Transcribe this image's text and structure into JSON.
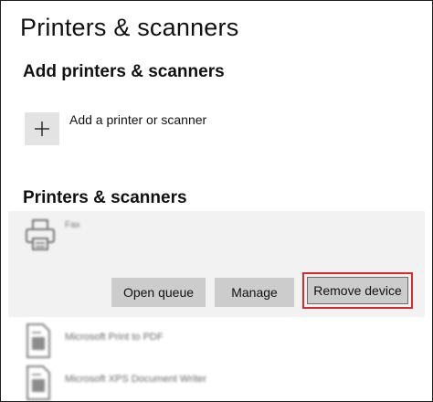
{
  "page": {
    "title": "Printers & scanners"
  },
  "add_section": {
    "heading": "Add printers & scanners",
    "add_label": "Add a printer or scanner"
  },
  "list_section": {
    "heading": "Printers & scanners",
    "selected": {
      "name": "Fax",
      "icon": "printer-icon",
      "buttons": {
        "open_queue": "Open queue",
        "manage": "Manage",
        "remove_device": "Remove device"
      }
    },
    "items": [
      {
        "name": "Microsoft Print to PDF",
        "icon": "document-icon"
      },
      {
        "name": "Microsoft XPS Document Writer",
        "icon": "document-icon"
      }
    ]
  },
  "colors": {
    "highlight": "#d92b2b",
    "button_bg": "#cccccc",
    "selected_row_bg": "#f2f2f2",
    "add_tile_bg": "#e3e3e3"
  }
}
